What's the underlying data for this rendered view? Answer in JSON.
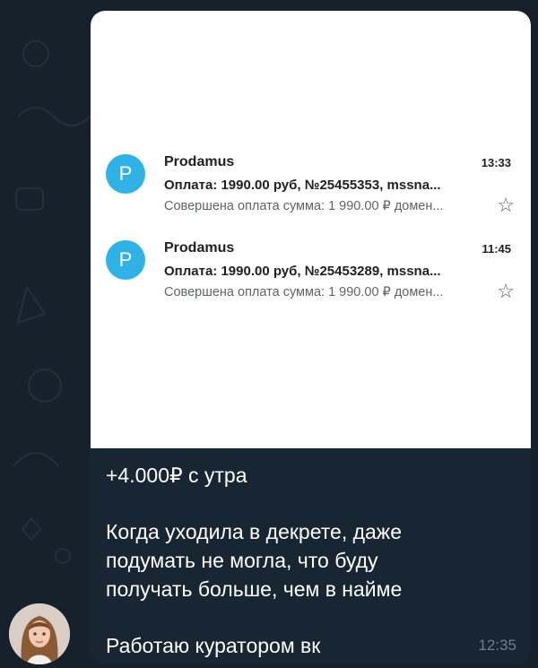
{
  "emails": [
    {
      "avatar_letter": "P",
      "sender": "Prodamus",
      "time": "13:33",
      "subject": "Оплата: 1990.00 руб, №25455353, mssna...",
      "snippet": "Совершена оплата сумма: 1 990.00 ₽ домен...",
      "star": "☆"
    },
    {
      "avatar_letter": "P",
      "sender": "Prodamus",
      "time": "11:45",
      "subject": "Оплата: 1990.00 руб, №25453289, mssna...",
      "snippet": "Совершена оплата сумма: 1 990.00 ₽ домен...",
      "star": "☆"
    }
  ],
  "message": {
    "line1": "+4.000₽ с утра",
    "line2": "Когда уходила в декрете, даже",
    "line3": "подумать не могла, что буду",
    "line4": "получать больше, чем в найме",
    "line5": "Работаю куратором вк",
    "time": "12:35"
  },
  "colors": {
    "chat_background": "#17212b",
    "bubble": "#182533",
    "avatar_blue": "#2fb3e6",
    "text_white": "#ffffff",
    "time_gray": "#6d7f8f"
  },
  "icons": [
    "star-outline-icon",
    "user-avatar-photo"
  ]
}
